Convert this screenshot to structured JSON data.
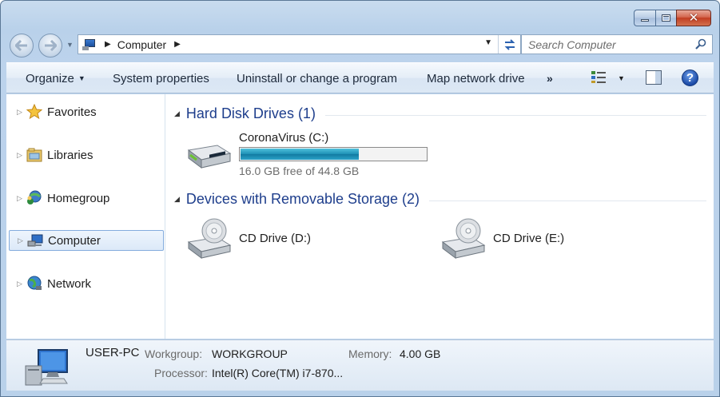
{
  "window": {
    "caption": {
      "minimize": "–",
      "maximize": "□",
      "close": "✕"
    }
  },
  "nav": {
    "back_icon": "back-arrow-icon",
    "forward_icon": "forward-arrow-icon",
    "address": {
      "segments": [
        "Computer"
      ]
    },
    "search": {
      "placeholder": "Search Computer"
    }
  },
  "toolbar": {
    "organize_label": "Organize",
    "system_properties_label": "System properties",
    "uninstall_label": "Uninstall or change a program",
    "map_network_label": "Map network drive",
    "more_label": "»"
  },
  "sidebar": {
    "items": [
      {
        "label": "Favorites",
        "icon": "star-icon"
      },
      {
        "label": "Libraries",
        "icon": "libraries-icon"
      },
      {
        "label": "Homegroup",
        "icon": "homegroup-icon"
      },
      {
        "label": "Computer",
        "icon": "computer-icon",
        "selected": true
      },
      {
        "label": "Network",
        "icon": "network-icon"
      }
    ]
  },
  "groups": {
    "hard_disks": {
      "title": "Hard Disk Drives (1)",
      "drives": [
        {
          "name": "CoronaVirus (C:)",
          "free_text": "16.0 GB free of 44.8 GB",
          "used_fraction": 0.643
        }
      ]
    },
    "removable": {
      "title": "Devices with Removable Storage (2)",
      "drives": [
        {
          "name": "CD Drive (D:)"
        },
        {
          "name": "CD Drive (E:)"
        }
      ]
    }
  },
  "details": {
    "computer_name": "USER-PC",
    "workgroup_label": "Workgroup:",
    "workgroup_value": "WORKGROUP",
    "memory_label": "Memory:",
    "memory_value": "4.00 GB",
    "processor_label": "Processor:",
    "processor_value": "Intel(R) Core(TM) i7-870..."
  },
  "colors": {
    "accent_title": "#1e3e8c",
    "bar_fill": "#1d8fb5",
    "frame": "#b9d1ea"
  }
}
